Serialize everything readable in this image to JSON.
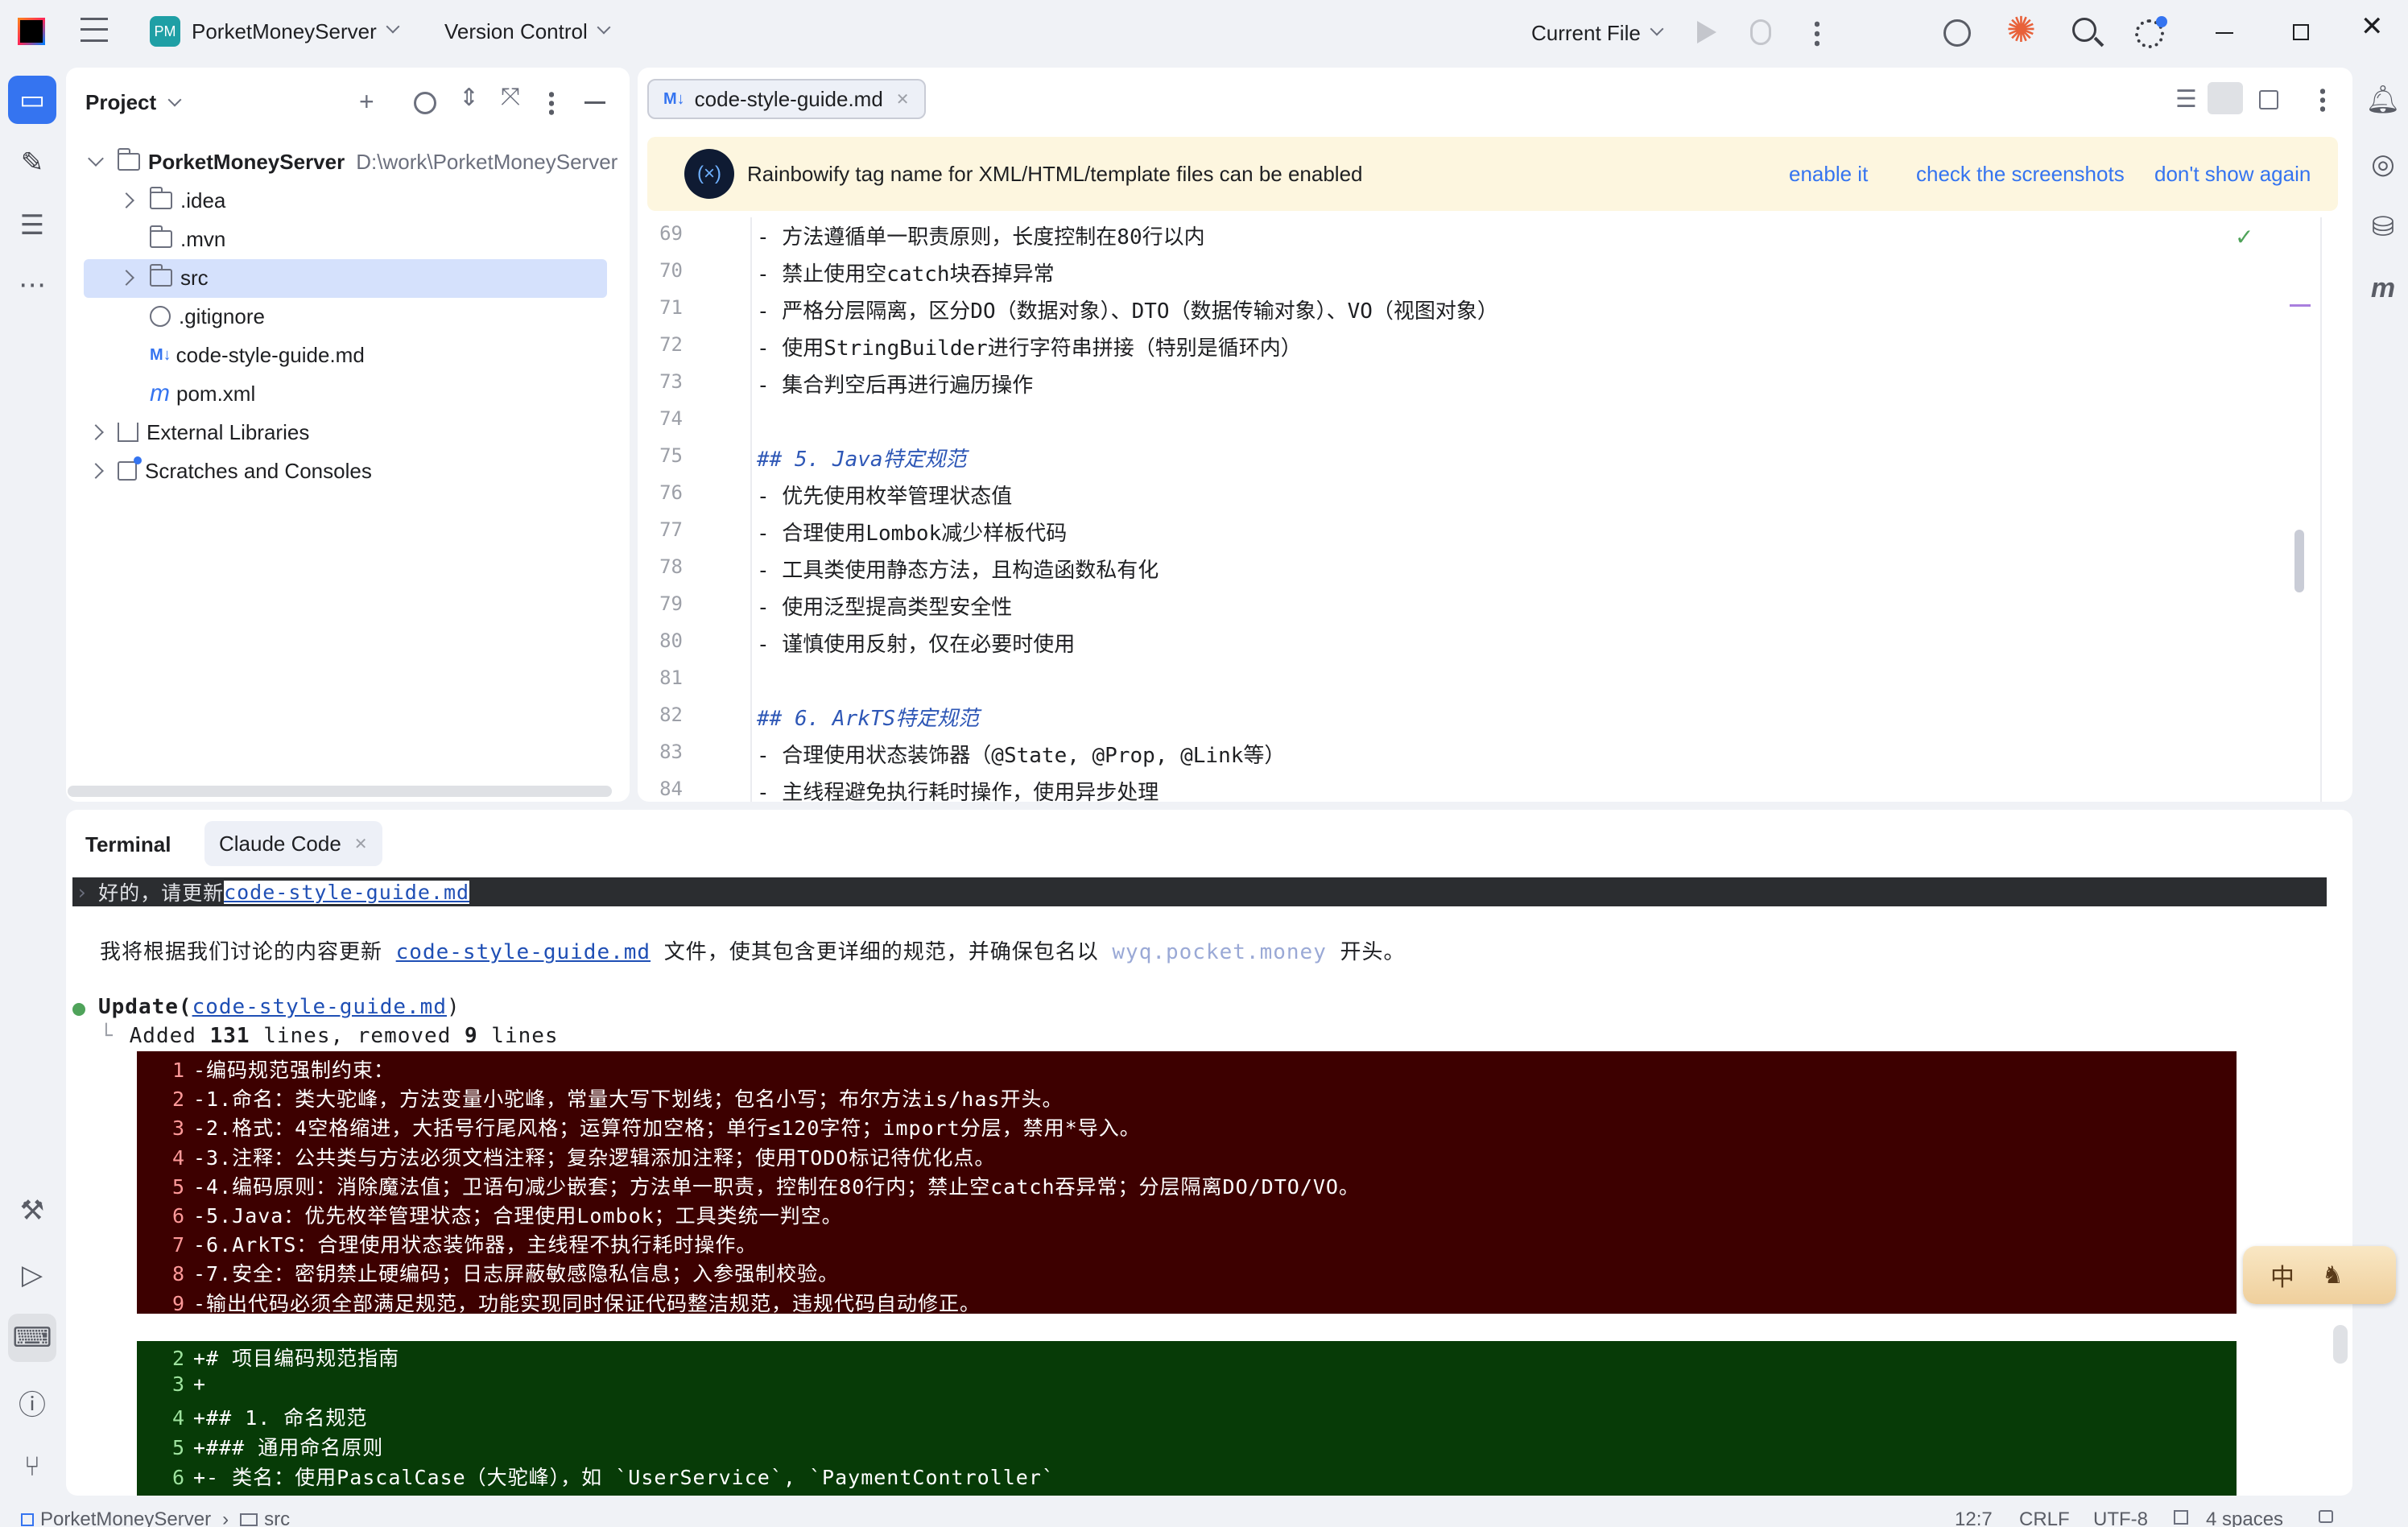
{
  "titlebar": {
    "project_badge": "PM",
    "project_name": "PorketMoneyServer",
    "vcs": "Version Control",
    "run_config": "Current File"
  },
  "project": {
    "header": "Project",
    "root_name": "PorketMoneyServer",
    "root_path": "D:\\work\\PorketMoneyServer",
    "items": [
      ".idea",
      ".mvn",
      "src",
      ".gitignore",
      "code-style-guide.md",
      "pom.xml"
    ],
    "external": "External Libraries",
    "scratches": "Scratches and Consoles"
  },
  "editor": {
    "tab_badge": "M↓",
    "tab_label": "code-style-guide.md",
    "banner_logo": "(×)",
    "banner_text": "Rainbowify tag name for XML/HTML/template files can be enabled",
    "banner_enable": "enable it",
    "banner_screens": "check the screenshots",
    "banner_dismiss": "don't show again",
    "line_numbers": [
      "69",
      "70",
      "71",
      "72",
      "73",
      "74",
      "75",
      "76",
      "77",
      "78",
      "79",
      "80",
      "81",
      "82",
      "83",
      "84"
    ],
    "lines": [
      "- 方法遵循单一职责原则，长度控制在80行以内",
      "- 禁止使用空catch块吞掉异常",
      "- 严格分层隔离，区分DO（数据对象）、DTO（数据传输对象）、VO（视图对象）",
      "- 使用StringBuilder进行字符串拼接（特别是循环内）",
      "- 集合判空后再进行遍历操作",
      "",
      "## 5. Java特定规范",
      "- 优先使用枚举管理状态值",
      "- 合理使用Lombok减少样板代码",
      "- 工具类使用静态方法，且构造函数私有化",
      "- 使用泛型提高类型安全性",
      "- 谨慎使用反射，仅在必要时使用",
      "",
      "## 6. ArkTS特定规范",
      "- 合理使用状态装饰器（@State, @Prop, @Link等）",
      "- 主线程避免执行耗时操作，使用异步处理"
    ]
  },
  "terminal": {
    "tab_terminal": "Terminal",
    "tab_claude": "Claude Code",
    "prompt_text": "好的，请更新 ",
    "prompt_link": "code-style-guide.md",
    "response_pre": "我将根据我们讨论的内容更新 ",
    "response_link": "code-style-guide.md",
    "response_mid": " 文件，使其包含更详细的规范，并确保包名以 ",
    "response_pkg": "wyq.pocket.money",
    "response_post": " 开头。",
    "update_label": "Update(",
    "update_file": "code-style-guide.md",
    "update_close": ")",
    "added_pre": "Added ",
    "added_num": "131",
    "added_mid": " lines, removed ",
    "removed_num": "9",
    "added_post": " lines",
    "deleted": [
      {
        "n": "1",
        "t": "-编码规范强制约束："
      },
      {
        "n": "2",
        "t": "-1.命名：类大驼峰，方法变量小驼峰，常量大写下划线；包名小写；布尔方法is/has开头。"
      },
      {
        "n": "3",
        "t": "-2.格式：4空格缩进，大括号行尾风格；运算符加空格；单行≤120字符；import分层，禁用*导入。"
      },
      {
        "n": "4",
        "t": "-3.注释：公共类与方法必须文档注释；复杂逻辑添加注释；使用TODO标记待优化点。"
      },
      {
        "n": "5",
        "t": "-4.编码原则：消除魔法值；卫语句减少嵌套；方法单一职责，控制在80行内；禁止空catch吞异常；分层隔离DO/DTO/VO。"
      },
      {
        "n": "6",
        "t": "-5.Java：优先枚举管理状态；合理使用Lombok；工具类统一判空。"
      },
      {
        "n": "7",
        "t": "-6.ArkTS：合理使用状态装饰器，主线程不执行耗时操作。"
      },
      {
        "n": "8",
        "t": "-7.安全：密钥禁止硬编码；日志屏蔽敏感隐私信息；入参强制校验。"
      },
      {
        "n": "9",
        "t": "-输出代码必须全部满足规范，功能实现同时保证代码整洁规范，违规代码自动修正。"
      }
    ],
    "added": [
      {
        "n": "2",
        "t": "+# 项目编码规范指南"
      },
      {
        "n": "3",
        "t": "+"
      },
      {
        "n": "4",
        "t": "+## 1. 命名规范"
      },
      {
        "n": "5",
        "t": "+### 通用命名原则"
      },
      {
        "n": "6",
        "t": "+- 类名：使用PascalCase（大驼峰），如 `UserService`, `PaymentController`"
      }
    ],
    "ime_label": "中"
  },
  "statusbar": {
    "crumb_project": "PorketMoneyServer",
    "crumb_src": "src",
    "position": "12:7",
    "line_sep": "CRLF",
    "encoding": "UTF-8",
    "indent": "4 spaces"
  }
}
